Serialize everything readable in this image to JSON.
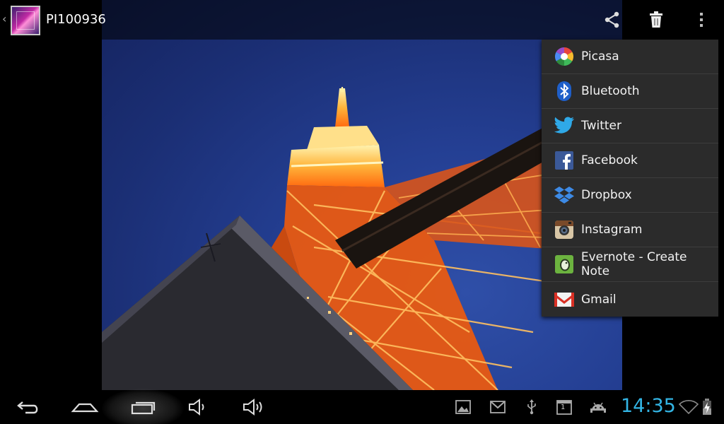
{
  "action_bar": {
    "title": "PI100936",
    "icons": [
      "gallery-thumbnail-icon",
      "share-icon",
      "delete-icon",
      "overflow-menu-icon"
    ]
  },
  "share_menu": {
    "items": [
      {
        "label": "Picasa",
        "icon": "picasa-icon"
      },
      {
        "label": "Bluetooth",
        "icon": "bluetooth-icon"
      },
      {
        "label": "Twitter",
        "icon": "twitter-icon"
      },
      {
        "label": "Facebook",
        "icon": "facebook-icon"
      },
      {
        "label": "Dropbox",
        "icon": "dropbox-icon"
      },
      {
        "label": "Instagram",
        "icon": "instagram-icon"
      },
      {
        "label": "Evernote - Create Note",
        "icon": "evernote-icon"
      },
      {
        "label": "Gmail",
        "icon": "gmail-icon"
      }
    ]
  },
  "system_bar": {
    "clock": "14:35",
    "calendar_day": "1",
    "nav": [
      "back-icon",
      "home-icon",
      "recent-apps-icon",
      "volume-down-icon",
      "volume-up-icon"
    ],
    "notifications": [
      "gallery-notification-icon",
      "gmail-notification-icon",
      "usb-icon",
      "calendar-icon",
      "android-debug-icon"
    ],
    "status": [
      "wifi-icon",
      "battery-charging-icon"
    ]
  },
  "colors": {
    "clock": "#33b5e5",
    "menu_bg": "#2b2b2b",
    "sky": "#1e3584",
    "tower": "#ff7a1a"
  }
}
